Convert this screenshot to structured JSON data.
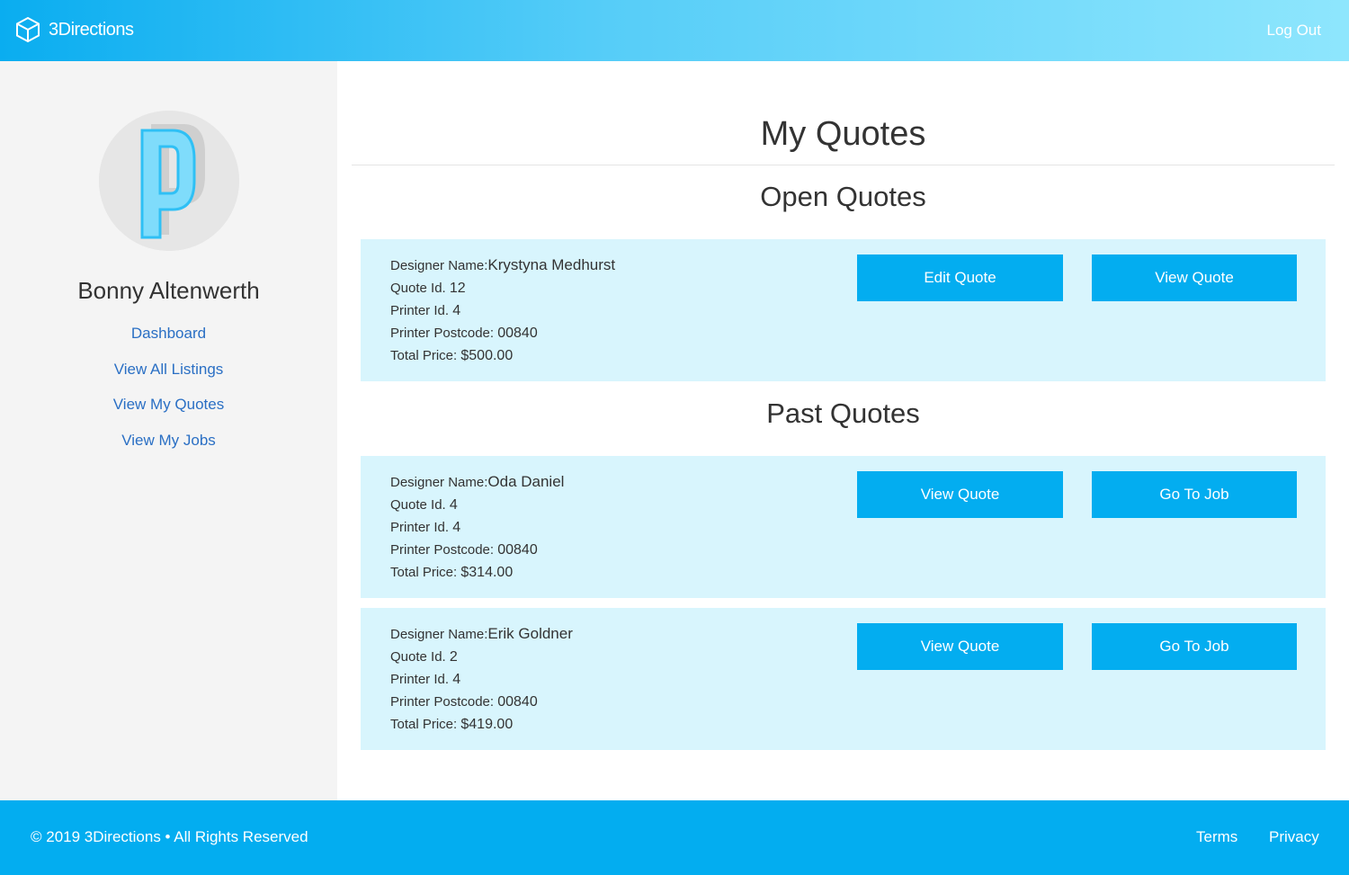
{
  "header": {
    "brand_name": "3Directions",
    "logout_label": "Log Out"
  },
  "sidebar": {
    "user_name": "Bonny Altenwerth",
    "nav": [
      {
        "label": "Dashboard"
      },
      {
        "label": "View All Listings"
      },
      {
        "label": "View My Quotes"
      },
      {
        "label": "View My Jobs"
      }
    ]
  },
  "main": {
    "title": "My Quotes",
    "open_heading": "Open Quotes",
    "past_heading": "Past Quotes",
    "field_labels": {
      "designer_name": "Designer Name:",
      "quote_id": "Quote Id. ",
      "printer_id": "Printer Id. ",
      "printer_postcode": "Printer Postcode: ",
      "total_price": "Total Price: "
    },
    "open_quotes": [
      {
        "designer_name": "Krystyna Medhurst",
        "quote_id": "12",
        "printer_id": "4",
        "printer_postcode": "00840",
        "total_price": "$500.00",
        "primary_button": "Edit Quote",
        "secondary_button": "View Quote"
      }
    ],
    "past_quotes": [
      {
        "designer_name": "Oda Daniel",
        "quote_id": "4",
        "printer_id": "4",
        "printer_postcode": "00840",
        "total_price": "$314.00",
        "primary_button": "View Quote",
        "secondary_button": "Go To Job"
      },
      {
        "designer_name": "Erik Goldner",
        "quote_id": "2",
        "printer_id": "4",
        "printer_postcode": "00840",
        "total_price": "$419.00",
        "primary_button": "View Quote",
        "secondary_button": "Go To Job"
      }
    ]
  },
  "footer": {
    "copyright": "© 2019 3Directions • All Rights Reserved",
    "terms_label": "Terms",
    "privacy_label": "Privacy"
  },
  "colors": {
    "accent": "#03adf0",
    "card_background": "#d8f5fd",
    "link": "#2a6fc4",
    "sidebar_background": "#f4f4f4"
  },
  "icons": {
    "brand": "cube-icon",
    "avatar": "letter-p-avatar"
  }
}
